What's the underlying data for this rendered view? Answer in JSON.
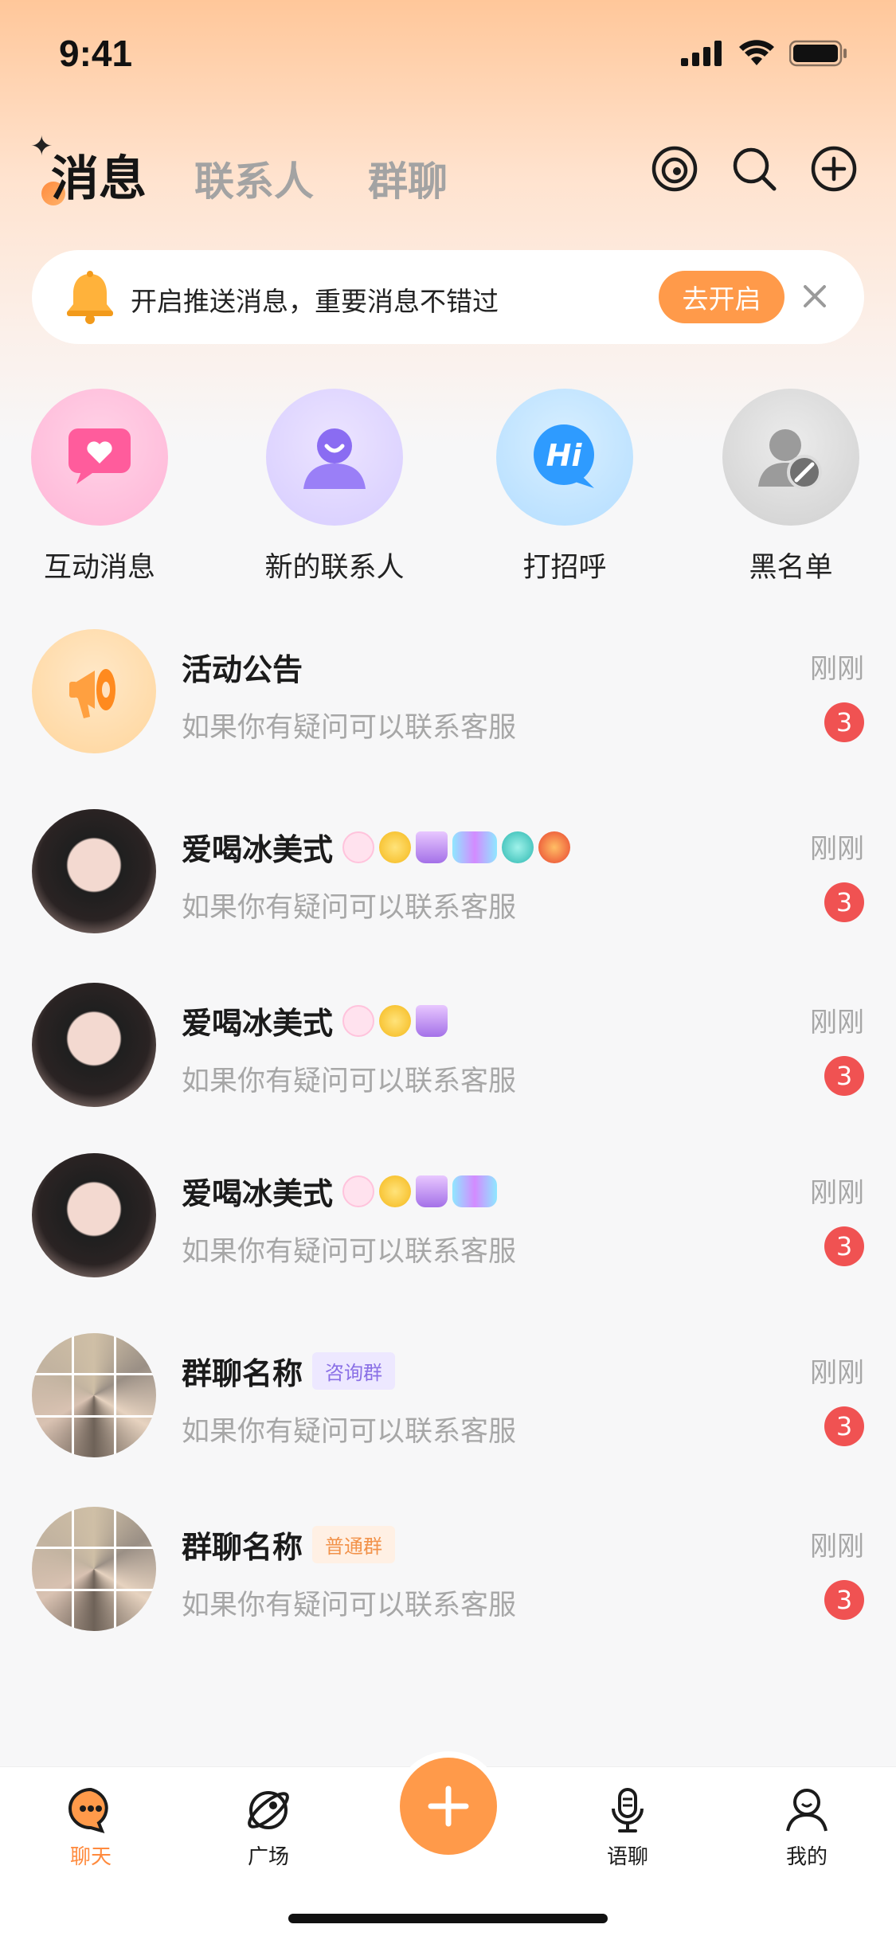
{
  "status": {
    "time": "9:41"
  },
  "header": {
    "tabs": [
      {
        "label": "消息",
        "active": true
      },
      {
        "label": "联系人",
        "active": false
      },
      {
        "label": "群聊",
        "active": false
      }
    ]
  },
  "banner": {
    "text": "开启推送消息，重要消息不错过",
    "button": "去开启"
  },
  "shortcuts": [
    {
      "label": "互动消息",
      "icon": "heart-message-icon"
    },
    {
      "label": "新的联系人",
      "icon": "new-contact-icon"
    },
    {
      "label": "打招呼",
      "icon": "hi-bubble-icon"
    },
    {
      "label": "黑名单",
      "icon": "blocked-user-icon"
    }
  ],
  "chats": [
    {
      "name": "活动公告",
      "message": "如果你有疑问可以联系客服",
      "time": "刚刚",
      "unread": "3"
    },
    {
      "name": "爱喝冰美式",
      "message": "如果你有疑问可以联系客服",
      "time": "刚刚",
      "unread": "3"
    },
    {
      "name": "爱喝冰美式",
      "message": "如果你有疑问可以联系客服",
      "time": "刚刚",
      "unread": "3"
    },
    {
      "name": "爱喝冰美式",
      "message": "如果你有疑问可以联系客服",
      "time": "刚刚",
      "unread": "3"
    },
    {
      "name": "群聊名称",
      "tag": "咨询群",
      "message": "如果你有疑问可以联系客服",
      "time": "刚刚",
      "unread": "3"
    },
    {
      "name": "群聊名称",
      "tag": "普通群",
      "message": "如果你有疑问可以联系客服",
      "time": "刚刚",
      "unread": "3"
    }
  ],
  "tabbar": {
    "items": [
      {
        "label": "聊天",
        "active": true
      },
      {
        "label": "广场",
        "active": false
      },
      {
        "label": "语聊",
        "active": false
      },
      {
        "label": "我的",
        "active": false
      }
    ]
  },
  "colors": {
    "accent": "#ff9a4a",
    "unread": "#f05252",
    "active_tab_label": "#ff8a3d"
  }
}
